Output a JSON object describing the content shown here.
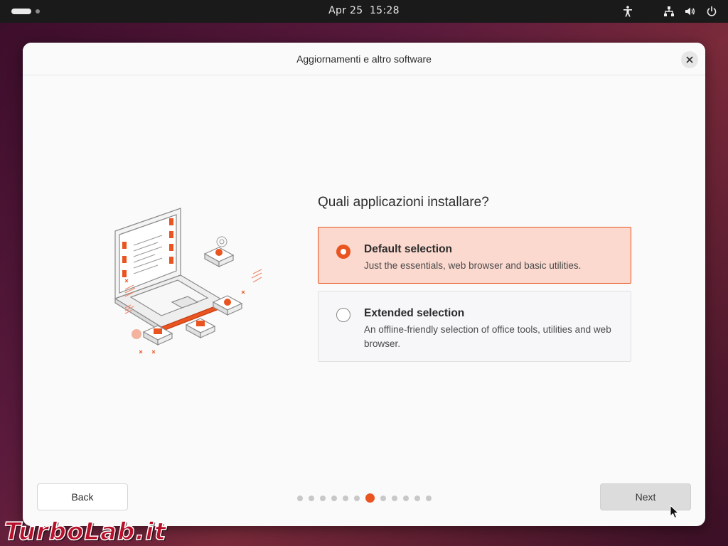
{
  "topbar": {
    "date": "Apr 25",
    "time": "15:28",
    "icons": [
      "accessibility-icon",
      "network-icon",
      "volume-icon",
      "power-icon"
    ]
  },
  "window": {
    "title": "Aggiornamenti e altro software",
    "question": "Quali applicazioni installare?",
    "options": [
      {
        "title": "Default selection",
        "description": "Just the essentials, web browser and basic utilities.",
        "selected": true
      },
      {
        "title": "Extended selection",
        "description": "An offline-friendly selection of office tools, utilities and web browser.",
        "selected": false
      }
    ],
    "back_label": "Back",
    "next_label": "Next",
    "progress": {
      "total_steps": 12,
      "current_step": 7
    }
  },
  "watermark": "TurboLab.it",
  "colors": {
    "accent": "#e95420",
    "selected_bg": "#fbd9cf",
    "topbar_bg": "#1a1a1a",
    "window_bg": "#fafafa"
  }
}
